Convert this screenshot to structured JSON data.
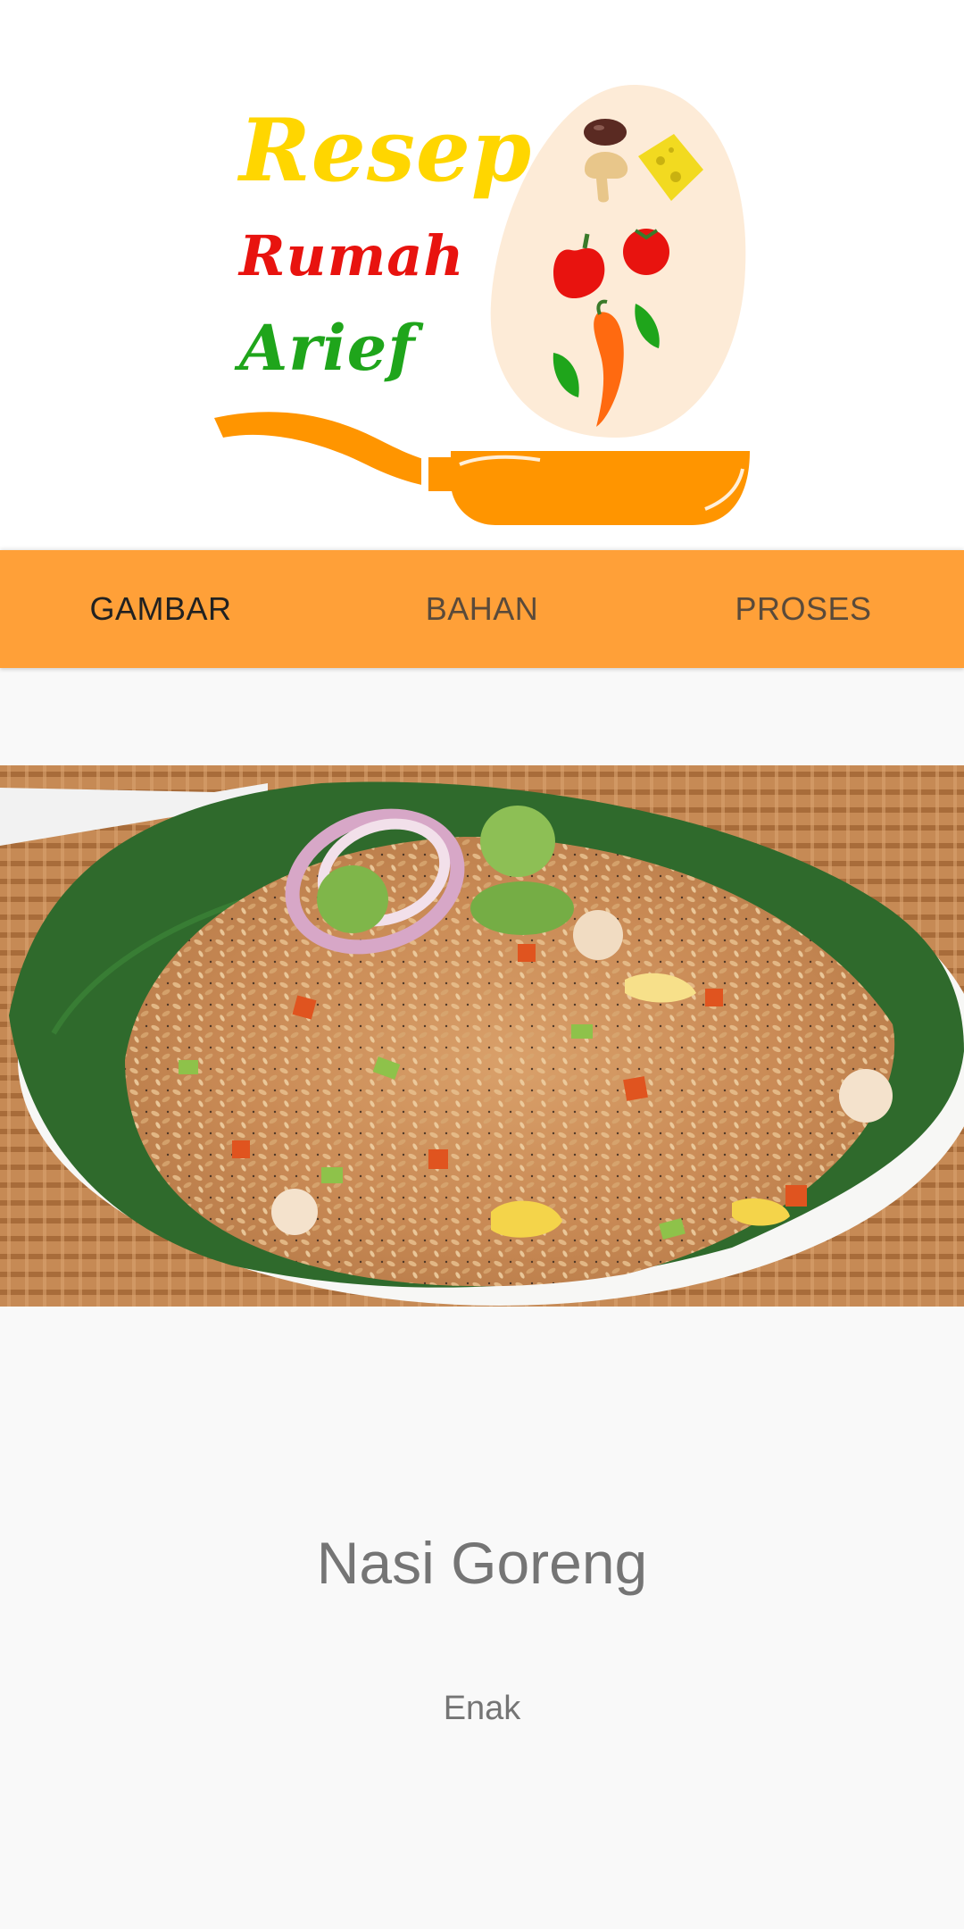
{
  "logo": {
    "line1": "Resep",
    "line2": "Rumah",
    "line3": "Arief",
    "line1_color": "#FFD600",
    "line2_color": "#E8130F",
    "line3_color": "#1FA51B",
    "pan_color": "#FF9500",
    "egg_color": "#FDEBD7"
  },
  "tabs": [
    {
      "label": "GAMBAR",
      "selected": true
    },
    {
      "label": "BAHAN",
      "selected": false
    },
    {
      "label": "PROSES",
      "selected": false
    }
  ],
  "colors": {
    "tabbar_bg": "#FFA038",
    "tab_selected_text": "#212121",
    "tab_unselected_text": "#5A4A3A",
    "body_bg": "#F9F9F9"
  },
  "recipe": {
    "image_icon": "fried-rice-photo",
    "name": "Nasi Goreng",
    "description": "Enak"
  }
}
